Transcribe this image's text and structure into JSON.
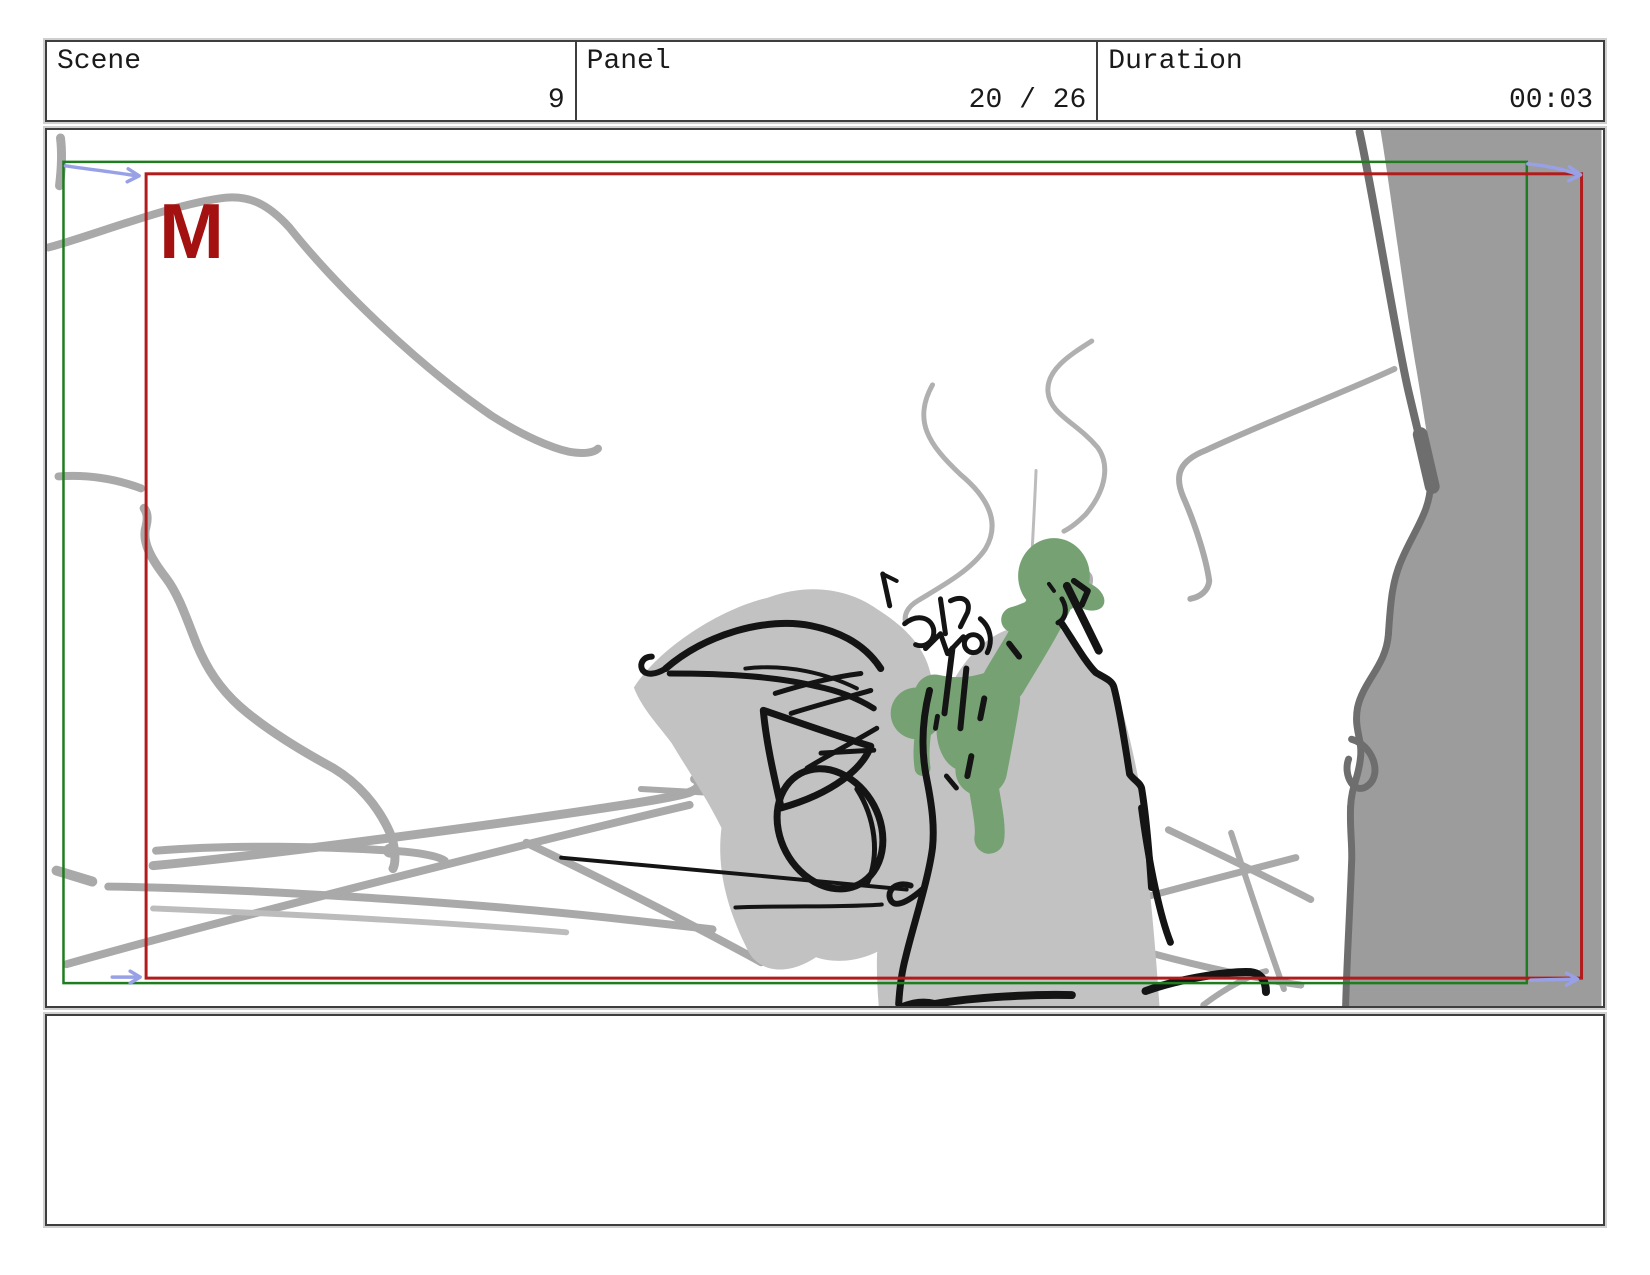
{
  "header": {
    "scene": {
      "label": "Scene",
      "value": "9"
    },
    "panel": {
      "label": "Panel",
      "value": "20 / 26"
    },
    "duration": {
      "label": "Duration",
      "value": "00:03"
    }
  },
  "board": {
    "marker_letter": "M"
  },
  "notes": {
    "content": ""
  },
  "colors": {
    "frame_start_green": "#1f7c1f",
    "frame_end_red": "#b11b1b",
    "marker_red": "#a31111",
    "camera_arrow_blue": "#98a1e6",
    "slime_green": "#76a173",
    "ink_black": "#141414",
    "wall_gray": "#9c9c9c",
    "wall_edge_gray": "#6e6e6e",
    "rock_gray": "#c2c2c2",
    "sketch_gray": "#a9a9a9",
    "box_border": "#3e3e3e"
  }
}
